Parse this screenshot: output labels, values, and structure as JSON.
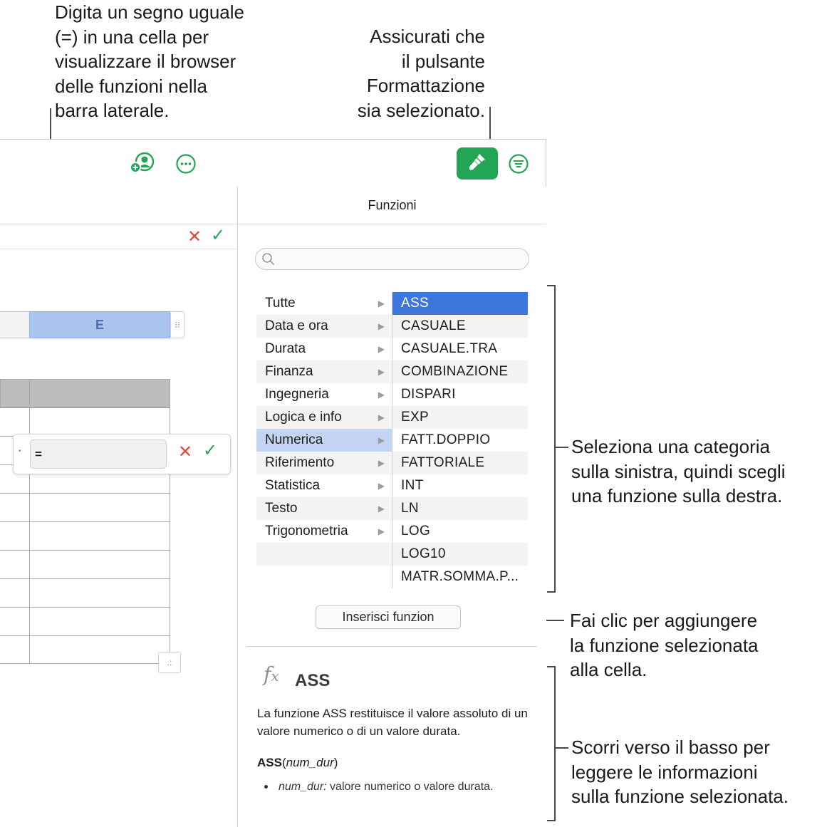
{
  "callouts": {
    "top_left": "Digita un segno uguale\n(=) in una cella per\nvisualizzare il browser\ndelle funzioni nella\nbarra laterale.",
    "top_right": "Assicurati che\nil pulsante\nFormattazione\nsia selezionato.",
    "middle_right": "Seleziona una categoria\nsulla sinistra, quindi scegli\nuna funzione sulla destra.",
    "insert_right": "Fai clic per aggiungere\nla funzione selezionata\nalla cella.",
    "bottom_right": "Scorri verso il basso per\nleggere le informazioni\nsulla funzione selezionata."
  },
  "toolbar": {
    "icons": [
      "add-collaborator-icon",
      "more-icon",
      "format-brush-icon",
      "organize-icon"
    ],
    "accent": "#22a655"
  },
  "spreadsheet": {
    "column_label": "E",
    "formula_value": "="
  },
  "sidebar": {
    "title": "Funzioni",
    "categories": [
      {
        "label": "Tutte"
      },
      {
        "label": "Data e ora"
      },
      {
        "label": "Durata"
      },
      {
        "label": "Finanza"
      },
      {
        "label": "Ingegneria"
      },
      {
        "label": "Logica e info"
      },
      {
        "label": "Numerica"
      },
      {
        "label": "Riferimento"
      },
      {
        "label": "Statistica"
      },
      {
        "label": "Testo"
      },
      {
        "label": "Trigonometria"
      }
    ],
    "selected_category": "Numerica",
    "functions": [
      "ASS",
      "CASUALE",
      "CASUALE.TRA",
      "COMBINAZIONE",
      "DISPARI",
      "EXP",
      "FATT.DOPPIO",
      "FATTORIALE",
      "INT",
      "LN",
      "LOG",
      "LOG10",
      "MATR.SOMMA.P..."
    ],
    "selected_function": "ASS",
    "insert_button": "Inserisci funzion",
    "detail": {
      "name": "ASS",
      "description": "La funzione ASS restituisce il valore assoluto di un valore numerico o di un valore durata.",
      "syntax_name": "ASS",
      "syntax_open": "(",
      "syntax_arg": "num_dur",
      "syntax_close": ")",
      "param_name": "num_dur:",
      "param_text": " valore numerico o valore durata."
    },
    "selection_color": "#3f76dd"
  }
}
